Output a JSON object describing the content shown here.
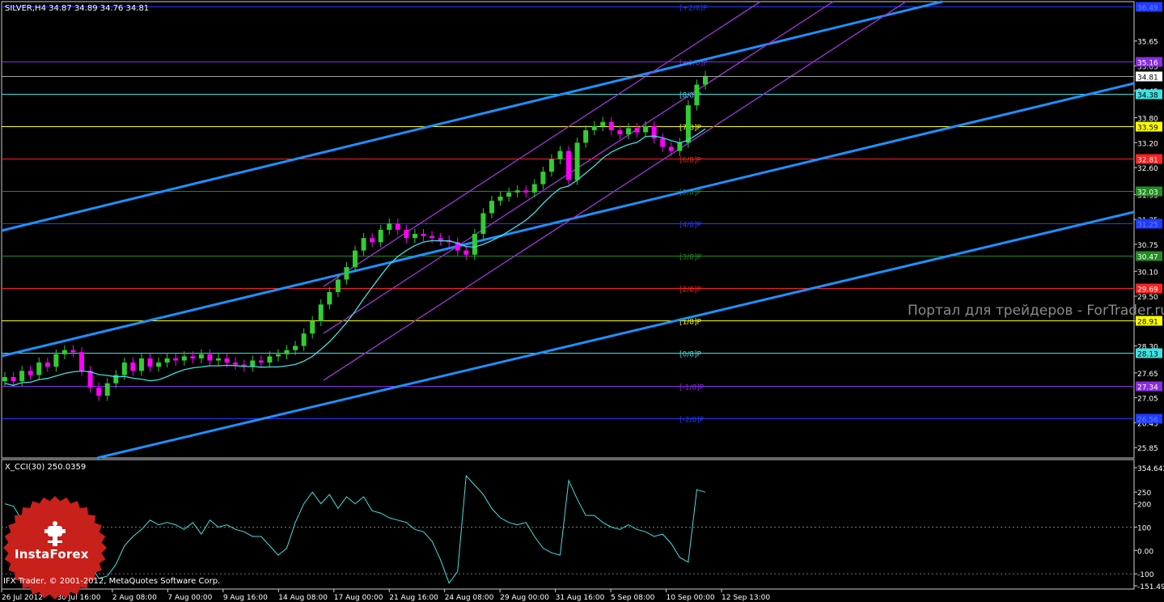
{
  "header": {
    "symbol_line": "SILVER,H4  34.87 34.89 34.76 34.81",
    "indicator_line": "X_CCI(30) 250.0359"
  },
  "watermark": "Портал для трейдеров - ForTrader.ru",
  "logo": {
    "name": "InstaForex"
  },
  "copyright": "IFX Trader, © 2001-2012, MetaQuotes Software Corp.",
  "price_axis": {
    "ticks": [
      "35.65",
      "35.05",
      "34.45",
      "33.80",
      "33.20",
      "32.60",
      "31.95",
      "31.35",
      "30.75",
      "30.10",
      "29.50",
      "28.90",
      "28.30",
      "27.65",
      "27.05",
      "26.45",
      "25.85"
    ],
    "range": [
      25.6,
      36.6
    ]
  },
  "cci_axis": {
    "ticks": [
      "354.642",
      "250",
      "200",
      "100",
      "0.00",
      "-100",
      "-151.490"
    ],
    "range": [
      -151.49,
      354.642
    ]
  },
  "time_axis": {
    "labels": [
      "26 Jul 2012",
      "30 Jul 16:00",
      "2 Aug 08:00",
      "7 Aug 00:00",
      "9 Aug 16:00",
      "14 Aug 08:00",
      "17 Aug 00:00",
      "21 Aug 16:00",
      "24 Aug 08:00",
      "29 Aug 00:00",
      "31 Aug 16:00",
      "5 Sep 08:00",
      "10 Sep 00:00",
      "12 Sep 13:00"
    ]
  },
  "murrey_levels": [
    {
      "label": "[+2/8]P",
      "price": 36.49,
      "tag": "36.49",
      "color": "#1e3cff",
      "tag_text": "#6a7cff"
    },
    {
      "label": "[+1/8]P",
      "price": 35.16,
      "tag": "35.16",
      "color": "#8a2be2",
      "tag_text": "#ffffff"
    },
    {
      "label": "[8/8]P",
      "price": 34.38,
      "tag": "34.38",
      "color": "#40e0e0",
      "tag_text": "#000000"
    },
    {
      "label": "[7/8]P",
      "price": 33.59,
      "tag": "33.59",
      "color": "#ffff00",
      "tag_text": "#000000"
    },
    {
      "label": "[6/8]P",
      "price": 32.81,
      "tag": "32.81",
      "color": "#ff2020",
      "tag_text": "#ffffff"
    },
    {
      "label": "[5/8]P",
      "price": 32.03,
      "tag": "32.03",
      "color": "#228b22",
      "tag_text": "#ffffff"
    },
    {
      "label": "[4/8]P",
      "price": 31.25,
      "tag": "31.25",
      "color": "#1e3cff",
      "tag_text": "#6a7cff"
    },
    {
      "label": "[3/8]P",
      "price": 30.47,
      "tag": "30.47",
      "color": "#228b22",
      "tag_text": "#ffffff"
    },
    {
      "label": "[2/8]P",
      "price": 29.69,
      "tag": "29.69",
      "color": "#ff2020",
      "tag_text": "#ffffff"
    },
    {
      "label": "[1/8]P",
      "price": 28.91,
      "tag": "28.91",
      "color": "#ffff00",
      "tag_text": "#000000"
    },
    {
      "label": "[0/8]P",
      "price": 28.13,
      "tag": "28.13",
      "color": "#40e0e0",
      "tag_text": "#000000"
    },
    {
      "label": "[-1/8]P",
      "price": 27.34,
      "tag": "27.34",
      "color": "#8a2be2",
      "tag_text": "#ffffff"
    },
    {
      "label": "[-2/8]P",
      "price": 26.56,
      "tag": "26.56",
      "color": "#1e3cff",
      "tag_text": "#6a7cff"
    }
  ],
  "current_price": {
    "tag": "34.81",
    "price": 34.81
  },
  "colors": {
    "background": "#000000",
    "bull_candle": "#32cd32",
    "bear_candle": "#ff00ff",
    "moving_average": "#40e0e0",
    "trend_channel": "#1e90ff",
    "regression_channel": "#9932cc",
    "cci_line": "#40e0e0"
  },
  "chart_data": {
    "type": "line",
    "title": "SILVER,H4",
    "price_ylim": [
      25.6,
      36.6
    ],
    "price_series_close": [
      27.55,
      27.45,
      27.7,
      27.6,
      27.9,
      27.8,
      28.1,
      28.2,
      28.15,
      27.7,
      27.3,
      27.1,
      27.4,
      27.6,
      27.9,
      27.7,
      28.0,
      27.8,
      27.9,
      28.0,
      27.95,
      28.05,
      28.0,
      28.1,
      27.95,
      28.0,
      27.9,
      27.85,
      27.8,
      27.95,
      27.9,
      28.05,
      28.1,
      28.2,
      28.3,
      28.6,
      28.9,
      29.3,
      29.6,
      29.9,
      30.2,
      30.6,
      30.9,
      30.8,
      31.1,
      31.25,
      31.1,
      30.9,
      31.0,
      30.95,
      30.9,
      30.85,
      30.8,
      30.6,
      30.5,
      31.0,
      31.5,
      31.8,
      31.9,
      32.0,
      32.05,
      32.0,
      32.2,
      32.5,
      32.8,
      33.0,
      32.3,
      33.2,
      33.5,
      33.6,
      33.7,
      33.5,
      33.4,
      33.55,
      33.45,
      33.6,
      33.3,
      33.1,
      33.0,
      33.2,
      34.1,
      34.6,
      34.81
    ],
    "cci_series": [
      200,
      190,
      130,
      140,
      70,
      50,
      90,
      180,
      200,
      80,
      -60,
      -120,
      -110,
      -60,
      20,
      60,
      90,
      130,
      110,
      120,
      110,
      90,
      120,
      70,
      130,
      100,
      110,
      90,
      80,
      60,
      60,
      20,
      -20,
      10,
      120,
      200,
      250,
      200,
      240,
      180,
      230,
      200,
      230,
      170,
      160,
      140,
      130,
      120,
      90,
      80,
      40,
      -40,
      -140,
      -90,
      320,
      280,
      240,
      180,
      140,
      120,
      110,
      120,
      60,
      10,
      -10,
      -20,
      300,
      220,
      150,
      150,
      120,
      100,
      90,
      110,
      90,
      80,
      60,
      70,
      30,
      -30,
      -50,
      260,
      250
    ],
    "cci_ylim": [
      -151.49,
      354.642
    ]
  }
}
